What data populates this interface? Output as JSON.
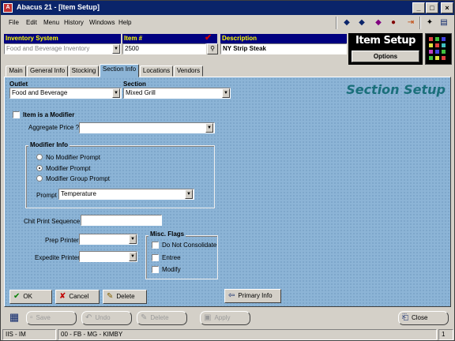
{
  "window": {
    "title": "Abacus 21 - [Item Setup]"
  },
  "menu": [
    "File",
    "Edit",
    "Menu",
    "History",
    "Windows",
    "Help"
  ],
  "header": {
    "inventory_label": "Inventory System",
    "inventory_value": "Food and Beverage Inventory",
    "item_label": "Item #",
    "item_value": "2500",
    "desc_label": "Description",
    "desc_value": "NY Strip Steak",
    "banner": "Item Setup",
    "options": "Options"
  },
  "tabs": [
    "Main",
    "General Info",
    "Stocking",
    "Section Info",
    "Locations",
    "Vendors"
  ],
  "active_tab": "Section Info",
  "panel": {
    "outlet_label": "Outlet",
    "outlet_value": "Food and Beverage",
    "section_label": "Section",
    "section_value": "Mixed Grill",
    "heading": "Section Setup",
    "is_modifier_label": "Item is a Modifier",
    "aggregate_label": "Aggregate Price ?",
    "aggregate_value": "",
    "modifier_info_title": "Modifier Info",
    "radios": [
      {
        "label": "No Modifier Prompt",
        "checked": false
      },
      {
        "label": "Modifier Prompt",
        "checked": true
      },
      {
        "label": "Modifier Group Prompt",
        "checked": false
      }
    ],
    "prompt_label": "Prompt",
    "prompt_value": "Temperature",
    "chit_label": "Chit Print Sequence",
    "chit_value": "",
    "prep_label": "Prep Printer",
    "prep_value": "",
    "expedite_label": "Expedite Printer",
    "expedite_value": "",
    "misc_title": "Misc. Flags",
    "flags": [
      "Do Not Consolidate",
      "Entree",
      "Modify"
    ],
    "ok": "OK",
    "cancel": "Cancel",
    "delete": "Delete",
    "primary_info": "Primary Info"
  },
  "bottom": {
    "save": "Save",
    "undo": "Undo",
    "delete": "Delete",
    "apply": "Apply",
    "close": "Close"
  },
  "status": {
    "left": "IIS - IM",
    "middle": "00 - FB - MG - KIMBY",
    "right": "1"
  },
  "colors": {
    "title": "#0a246a",
    "header_label": "#000080",
    "panel": "#8cb4d6",
    "heading": "#1a6f7a"
  }
}
